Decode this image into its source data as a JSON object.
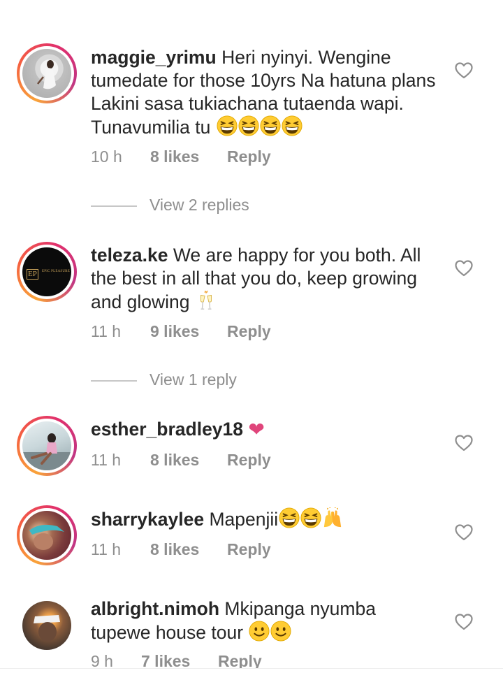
{
  "comments": [
    {
      "username": "maggie_yrimu",
      "text": "Heri nyinyi. Wengine tumedate for those 10yrs Na hatuna plans Lakini sasa tukiachana tutaenda wapi. Tunavumilia tu",
      "emoji": [
        "grinning-squint-face",
        "grinning-squint-face",
        "grinning-squint-face",
        "grinning-squint-face"
      ],
      "time": "10 h",
      "likes": "8 likes",
      "reply": "Reply",
      "view_replies": "View 2 replies"
    },
    {
      "username": "teleza.ke",
      "text": "We are happy for you both. All the best in all that you do, keep growing and glowing",
      "emoji": [
        "clinking-glasses"
      ],
      "avatar_text": "EP",
      "avatar_subtext": "EPIC PLEASURE",
      "time": "11 h",
      "likes": "9 likes",
      "reply": "Reply",
      "view_replies": "View 1 reply"
    },
    {
      "username": "esther_bradley18",
      "text": "❤",
      "time": "11 h",
      "likes": "8 likes",
      "reply": "Reply"
    },
    {
      "username": "sharrykaylee",
      "text": "Mapenjii",
      "emoji": [
        "grinning-squint-face",
        "grinning-squint-face",
        "raising-hands"
      ],
      "time": "11 h",
      "likes": "8 likes",
      "reply": "Reply"
    },
    {
      "username": "albright.nimoh",
      "text": "Mkipanga nyumba tupewe house tour",
      "emoji": [
        "slightly-smiling-face",
        "slightly-smiling-face"
      ],
      "time": "9 h",
      "likes": "7 likes",
      "reply": "Reply"
    }
  ],
  "colors": {
    "story_ring": [
      "#f9a33a",
      "#e1306c",
      "#c13584"
    ],
    "text": "#262626",
    "meta": "#8e8e8e"
  },
  "icons": {
    "like": "heart-outline-icon"
  }
}
